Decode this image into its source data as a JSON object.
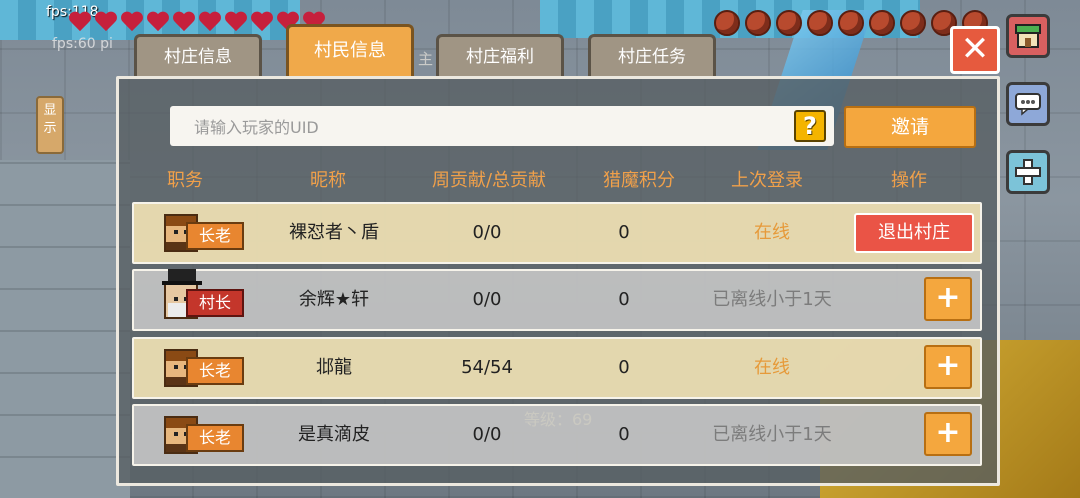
{
  "hud": {
    "fps_label": "fps:118",
    "fps_label2": "fps:60 pi",
    "side_tab_label": "显示",
    "behind_text": "主",
    "level_text": "等级：69"
  },
  "tabs": [
    {
      "label": "村庄信息",
      "active": false
    },
    {
      "label": "村民信息",
      "active": true
    },
    {
      "label": "村庄福利",
      "active": false
    },
    {
      "label": "村庄任务",
      "active": false
    }
  ],
  "close_label": "✕",
  "search": {
    "placeholder": "请输入玩家的UID",
    "value": ""
  },
  "help_label": "?",
  "invite_label": "邀请",
  "columns": [
    "职务",
    "昵称",
    "周贡献/总贡献",
    "猎魔积分",
    "上次登录",
    "操作"
  ],
  "members": [
    {
      "role": "长老",
      "name": "裸怼者丶盾",
      "contribution": "0/0",
      "points": "0",
      "last_login": "在线",
      "online": true,
      "action": "退出村庄"
    },
    {
      "role": "村长",
      "name": "余辉★轩",
      "contribution": "0/0",
      "points": "0",
      "last_login": "已离线小于1天",
      "online": false,
      "action": "+"
    },
    {
      "role": "长老",
      "name": "邶龍",
      "contribution": "54/54",
      "points": "0",
      "last_login": "在线",
      "online": true,
      "action": "+"
    },
    {
      "role": "长老",
      "name": "是真滴皮",
      "contribution": "0/0",
      "points": "0",
      "last_login": "已离线小于1天",
      "online": false,
      "action": "+"
    }
  ],
  "icons": [
    "heart-icon",
    "meat-icon",
    "shop-icon",
    "chat-icon",
    "plus-icon",
    "close-icon",
    "help-icon"
  ],
  "colors": {
    "accent": "#f0a94a",
    "danger": "#ea5446",
    "online": "#e69a3a",
    "offline": "#7c7c7c"
  }
}
